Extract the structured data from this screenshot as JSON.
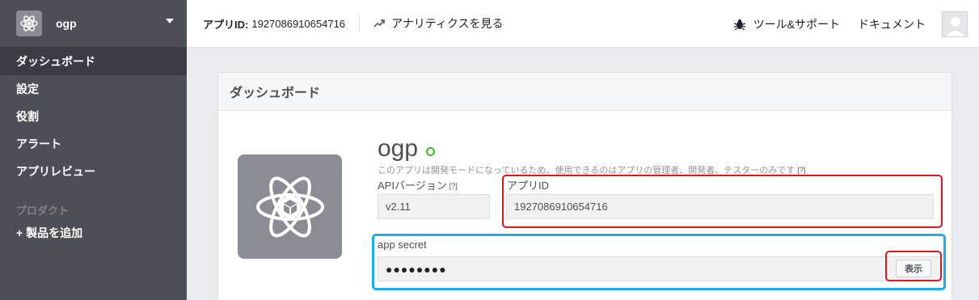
{
  "sidebar": {
    "app_name": "ogp",
    "items": [
      {
        "label": "ダッシュボード",
        "active": true
      },
      {
        "label": "設定"
      },
      {
        "label": "役割"
      },
      {
        "label": "アラート"
      },
      {
        "label": "アプリレビュー"
      }
    ],
    "section_label": "プロダクト",
    "add_product_label": "+ 製品を追加"
  },
  "topbar": {
    "app_id_label": "アプリID:",
    "app_id_value": "1927086910654716",
    "analytics_label": "アナリティクスを見る",
    "tools_label": "ツール&サポート",
    "docs_label": "ドキュメント"
  },
  "panel": {
    "title": "ダッシュボード",
    "app_title": "ogp",
    "dev_note": "このアプリは開発モードになっているため、使用できるのはアプリの管理者、開発者、テスターのみです",
    "help_mark": "[?]",
    "api_version_label": "APIバージョン",
    "api_version_value": "v2.11",
    "app_id_label": "アプリID",
    "app_id_value": "1927086910654716",
    "app_secret_label": "app secret",
    "app_secret_value": "●●●●●●●●",
    "show_button_label": "表示"
  },
  "colors": {
    "sidebar_bg": "#4b4f56",
    "status_green": "#42b72a",
    "highlight_red": "#e0141e",
    "highlight_blue": "#1ab0e6"
  },
  "icons": {
    "app_logo": "atom-icon",
    "analytics": "trend-arrow-icon",
    "tools": "bug-icon",
    "dropdown": "caret-down-icon",
    "avatar": "avatar-placeholder"
  }
}
